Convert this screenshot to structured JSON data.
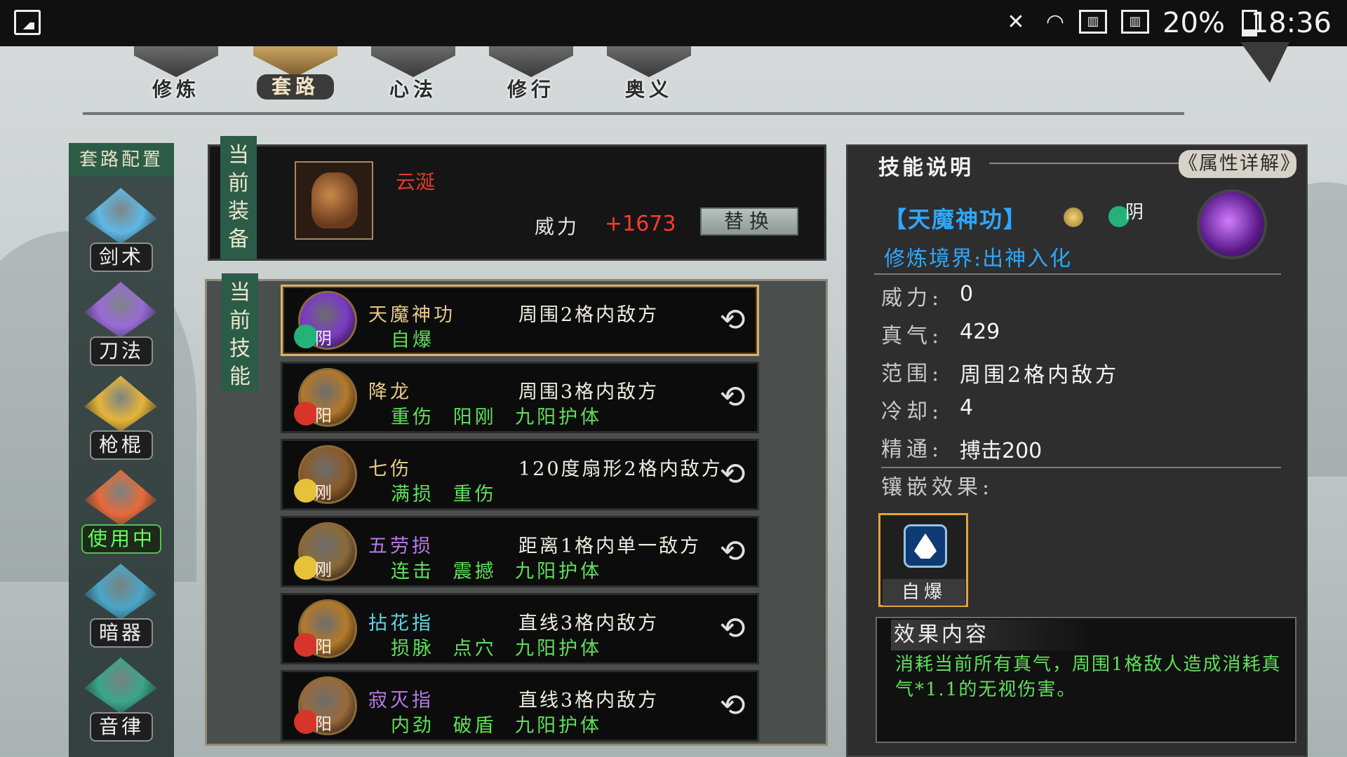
{
  "status_bar": {
    "battery": "20%",
    "time": "18:36"
  },
  "top_tabs": [
    {
      "label": "修炼",
      "active": false
    },
    {
      "label": "套路",
      "active": true
    },
    {
      "label": "心法",
      "active": false
    },
    {
      "label": "修行",
      "active": false
    },
    {
      "label": "奥义",
      "active": false
    }
  ],
  "left_rail": {
    "title": "套路配置",
    "categories": [
      {
        "label": "剑术",
        "icon": "sword-icon",
        "color": "#5fb8e6"
      },
      {
        "label": "刀法",
        "icon": "blade-icon",
        "color": "#9a6ad6"
      },
      {
        "label": "枪棍",
        "icon": "spear-icon",
        "color": "#e6b43a"
      },
      {
        "label": "使用中",
        "icon": "fist-icon",
        "color": "#e66a3a",
        "active": true
      },
      {
        "label": "暗器",
        "icon": "hidden-weapon-icon",
        "color": "#4aa6c6"
      },
      {
        "label": "音律",
        "icon": "music-icon",
        "color": "#3aa68a"
      }
    ]
  },
  "equipment": {
    "tag": "当前装备",
    "item_name": "云涎",
    "power_label": "威力",
    "power_value": "+1673",
    "replace_label": "替换"
  },
  "skills": {
    "tag": "当前技能",
    "list": [
      {
        "name": "天魔神功",
        "name_color": "#e6c98a",
        "element": "阴",
        "element_color": "#25b27a",
        "orb_color": "#7a3ac6",
        "range": "周围2格内敌方",
        "effects": "自爆",
        "selected": true
      },
      {
        "name": "降龙",
        "name_color": "#e6c98a",
        "element": "阳",
        "element_color": "#d8352a",
        "orb_color": "#b4782a",
        "range": "周围3格内敌方",
        "effects": "重伤 阳刚 九阳护体"
      },
      {
        "name": "七伤",
        "name_color": "#e6c98a",
        "element": "刚",
        "element_color": "#e6c23a",
        "orb_color": "#8a5a2a",
        "range": "120度扇形2格内敌方",
        "effects": "满损 重伤"
      },
      {
        "name": "五劳损",
        "name_color": "#b87ae6",
        "element": "刚",
        "element_color": "#e6c23a",
        "orb_color": "#8a6a3a",
        "range": "距离1格内单一敌方",
        "effects": "连击 震撼 九阳护体"
      },
      {
        "name": "拈花指",
        "name_color": "#5fd4e6",
        "element": "阳",
        "element_color": "#d8352a",
        "orb_color": "#b47a2a",
        "range": "直线3格内敌方",
        "effects": "损脉 点穴 九阳护体"
      },
      {
        "name": "寂灭指",
        "name_color": "#b87ae6",
        "element": "阳",
        "element_color": "#d8352a",
        "orb_color": "#9a6a3a",
        "range": "直线3格内敌方",
        "effects": "内劲 破盾 九阳护体"
      }
    ]
  },
  "description": {
    "title": "技能说明",
    "attr_button": "《属性详解》",
    "skill_title": "【天魔神功】",
    "element_label": "阴",
    "realm": "修炼境界:出神入化",
    "stats": [
      {
        "label": "威力:",
        "value": "0"
      },
      {
        "label": "真气:",
        "value": "429"
      },
      {
        "label": "范围:",
        "value": "周围2格内敌方"
      },
      {
        "label": "冷却:",
        "value": "4"
      },
      {
        "label": "精通:",
        "value": "搏击200"
      }
    ],
    "inlay_label": "镶嵌效果:",
    "inlay_name": "自爆",
    "effect_title": "效果内容",
    "effect_text": "消耗当前所有真气，周围1格敌人造成消耗真气*1.1的无视伤害。"
  }
}
